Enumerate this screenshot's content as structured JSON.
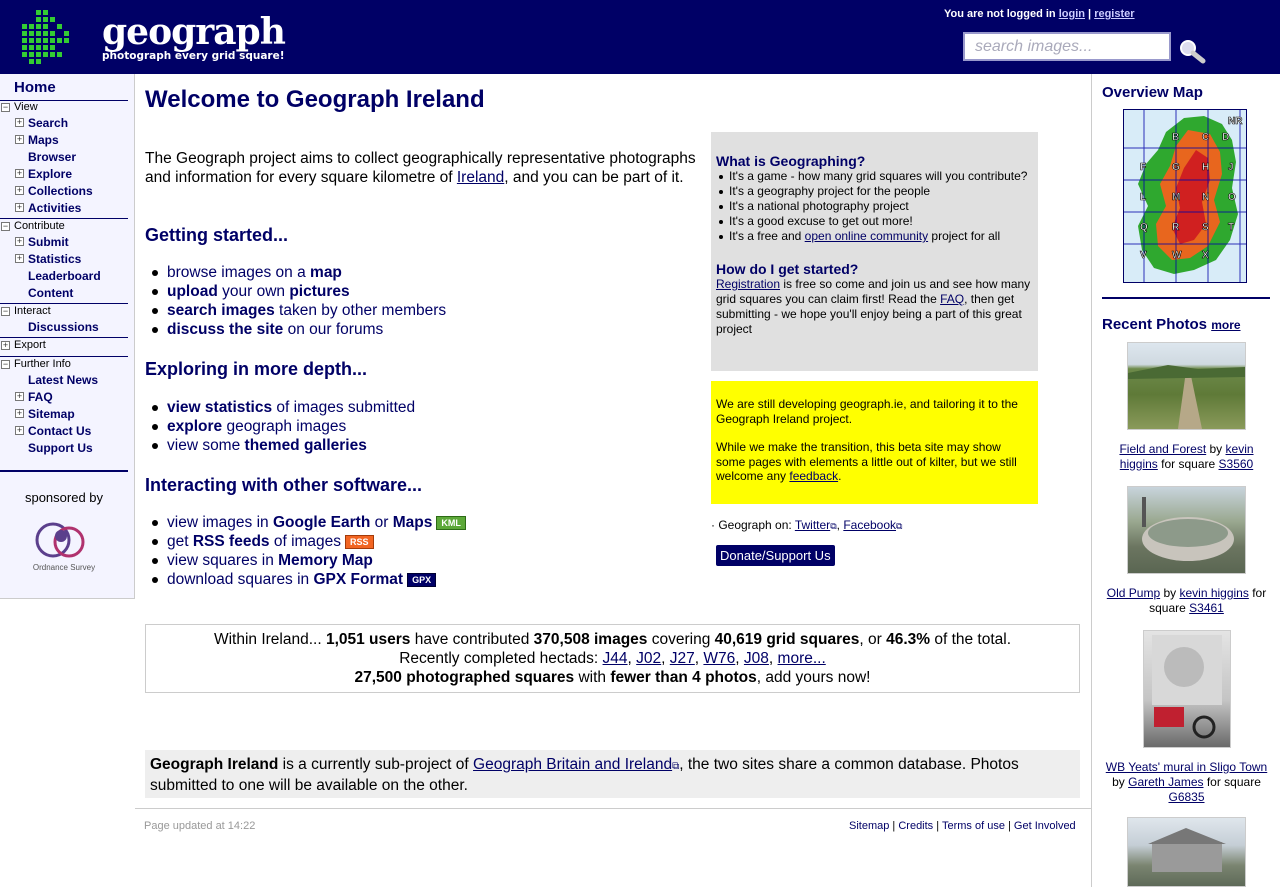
{
  "header": {
    "logo_text": "geograph",
    "logo_tagline": "photograph every grid square!",
    "login_status": "You are not logged in",
    "login_link": "login",
    "separator": "|",
    "register_link": "register",
    "search_placeholder": "search images...",
    "search_icon": "magnifier-icon"
  },
  "sidebar": {
    "home": "Home",
    "sections": [
      {
        "title": "View",
        "items": [
          "Search",
          "Maps",
          "Browser",
          "Explore",
          "Collections",
          "Activities"
        ]
      },
      {
        "title": "Contribute",
        "items": [
          "Submit",
          "Statistics",
          "Leaderboard",
          "Content"
        ]
      },
      {
        "title": "Interact",
        "items": [
          "Discussions"
        ]
      },
      {
        "title": "Export",
        "items": []
      },
      {
        "title": "Further Info",
        "items": [
          "Latest News",
          "FAQ",
          "Sitemap",
          "Contact Us",
          "Support Us"
        ]
      }
    ],
    "sponsor_label": "sponsored by",
    "sponsor_name": "Ordnance Survey"
  },
  "main": {
    "title": "Welcome to Geograph Ireland",
    "intro_1": "The Geograph project aims to collect geographically representative photographs and information for every square kilometre of ",
    "intro_link": "Ireland",
    "intro_2": ", and you can be part of it.",
    "getting_started": {
      "heading": "Getting started...",
      "items": [
        {
          "a": "browse images on a ",
          "b": "map",
          "c": ""
        },
        {
          "a": "",
          "b": "upload",
          "c": " your own ",
          "d": "pictures"
        },
        {
          "a": "",
          "b": "search images",
          "c": " taken by other members"
        },
        {
          "a": "",
          "b": "discuss the site",
          "c": " on our forums"
        }
      ]
    },
    "exploring": {
      "heading": "Exploring in more depth...",
      "items": [
        {
          "b": "view statistics",
          "c": " of images submitted"
        },
        {
          "b": "explore",
          "c": " geograph images"
        },
        {
          "a": "view some ",
          "b": "themed galleries"
        }
      ]
    },
    "interacting": {
      "heading": "Interacting with other software...",
      "items": [
        {
          "a": "view images in ",
          "b": "Google Earth",
          "c": " or ",
          "d": "Maps",
          "badge": "KML"
        },
        {
          "a": "get ",
          "b": "RSS feeds",
          "c": " of images",
          "badge": "RSS"
        },
        {
          "a": "view squares in ",
          "b": "Memory Map"
        },
        {
          "a": "download squares in ",
          "b": "GPX Format",
          "badge": "GPX"
        }
      ]
    },
    "what_box": {
      "heading": "What is Geographing?",
      "bullets": [
        "It's a game - how many grid squares will you contribute?",
        "It's a geography project for the people",
        "It's a national photography project",
        "It's a good excuse to get out more!"
      ],
      "bullet5_a": "It's a free and ",
      "bullet5_link": "open online community",
      "bullet5_b": " project for all",
      "how_heading": "How do I get started?",
      "how_link1": "Registration",
      "how_text1": " is free so come and join us and see how many grid squares you can claim first! Read the ",
      "how_link2": "FAQ",
      "how_text2": ", then get submitting - we hope you'll enjoy being a part of this great project"
    },
    "yellow_box": {
      "p1": "We are still developing geograph.ie, and tailoring it to the Geograph Ireland project.",
      "p2a": "While we make the transition, this beta site may show some pages with elements a little out of kilter, but we still welcome any ",
      "p2link": "feedback",
      "p2b": "."
    },
    "social": {
      "prefix": "· Geograph on: ",
      "twitter": "Twitter",
      "comma": ",",
      "facebook": "Facebook"
    },
    "donate": "Donate/Support Us",
    "stats": {
      "t1": "Within Ireland... ",
      "users": "1,051 users",
      "t2": " have contributed ",
      "images": "370,508 images",
      "t3": " covering ",
      "squares": "40,619 grid squares",
      "t4": ", or ",
      "pct": "46.3%",
      "t5": " of the total.",
      "recent_label": "Recently completed hectads: ",
      "hectads": [
        "J44",
        "J02",
        "J27",
        "W76",
        "J08"
      ],
      "more": "more...",
      "photographed": "27,500 photographed squares",
      "t6": " with ",
      "fewer": "fewer than 4 photos",
      "t7": ", add yours now!"
    },
    "subproject": {
      "b": "Geograph Ireland",
      "t1": " is a currently sub-project of ",
      "link": "Geograph Britain and Ireland",
      "t2": ", the two sites share a common database. Photos submitted to one will be available on the other."
    }
  },
  "footer": {
    "updated": "Page updated at 14:22",
    "links": [
      "Sitemap",
      "Credits",
      "Terms of use",
      "Get Involved"
    ]
  },
  "right": {
    "overview_title": "Overview Map",
    "map_letters": [
      "NR",
      "B",
      "C",
      "D",
      "F",
      "G",
      "H",
      "J",
      "L",
      "M",
      "N",
      "O",
      "Q",
      "R",
      "S",
      "T",
      "V",
      "W",
      "X"
    ],
    "recent_title": "Recent Photos",
    "recent_more": "more",
    "photos": [
      {
        "title": "Field and Forest",
        "by": " by ",
        "author": "kevin higgins",
        "for": " for square ",
        "square": "S3560"
      },
      {
        "title": "Old Pump",
        "by": " by ",
        "author": "kevin higgins",
        "for": " for square ",
        "square": "S3461"
      },
      {
        "title": "WB Yeats' mural in Sligo Town",
        "by": " by ",
        "author": "Gareth James",
        "for": " for square ",
        "square": "G6835"
      }
    ]
  }
}
